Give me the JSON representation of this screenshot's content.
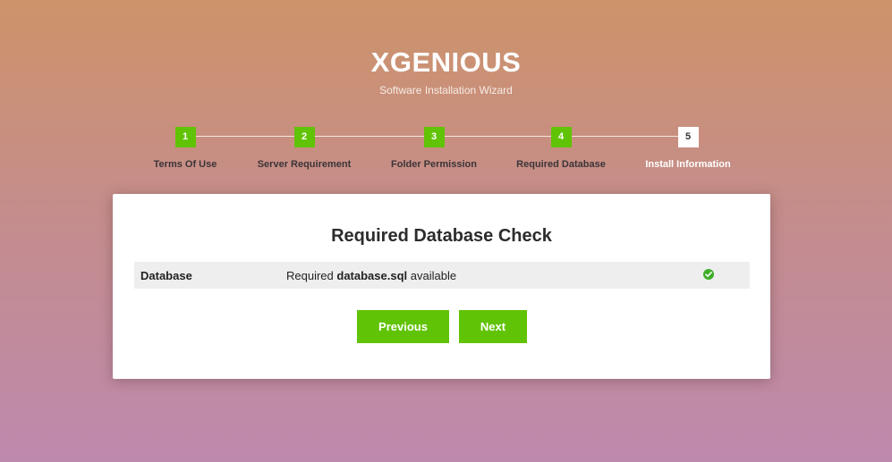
{
  "header": {
    "title": "XGENIOUS",
    "subtitle": "Software Installation Wizard"
  },
  "steps": [
    {
      "number": "1",
      "label": "Terms Of Use",
      "state": "done"
    },
    {
      "number": "2",
      "label": "Server Requirement",
      "state": "done"
    },
    {
      "number": "3",
      "label": "Folder Permission",
      "state": "done"
    },
    {
      "number": "4",
      "label": "Required Database",
      "state": "done"
    },
    {
      "number": "5",
      "label": "Install Information",
      "state": "current"
    }
  ],
  "card": {
    "title": "Required Database Check",
    "row": {
      "name": "Database",
      "desc_prefix": "Required ",
      "desc_file": "database.sql",
      "desc_suffix": " available",
      "status_icon": "check-circle-icon"
    },
    "buttons": {
      "previous": "Previous",
      "next": "Next"
    }
  },
  "colors": {
    "accent": "#61c305",
    "check": "#3fae2a"
  }
}
